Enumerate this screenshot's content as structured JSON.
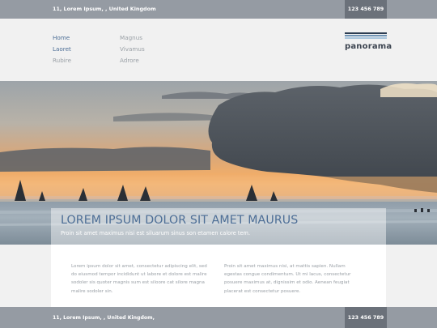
{
  "topbar": {
    "address": "11, Lorem Ipsum, , United Kingdom",
    "phone": "123 456 789"
  },
  "nav": {
    "col1": [
      "Home",
      "Laoret",
      "Rubire"
    ],
    "col2": [
      "Magnus",
      "Vivamus",
      "Adrore"
    ],
    "active": "Home"
  },
  "logo": {
    "text": "panorama"
  },
  "hero": {
    "title": "LOREM IPSUM DOLOR SIT AMET MAURUS",
    "subtitle": "Proin sit amet maximus nisi est siluarum sinus son etamen calore tem."
  },
  "content": {
    "left": "Lorem ipsum dolor sit amet, consectetur adipiscing elit, sed do eiusmod tempor incididunt ut labore et dolore est malire sodoler sis quoter magnis sum est siloore cat silore magna malire sodoler sin.",
    "right": "Proin sit amet maximus nisi, at mattis sapien. Nullam egestas congue condimentum. Ut mi lacus, consectetur posuere maximus at, dignissim et odio. Aenean feugiat placerat est consectetur posuere."
  },
  "footer": {
    "address": "11, Lorem Ipsum, , United Kingdom,",
    "phone": "123 456 789"
  }
}
